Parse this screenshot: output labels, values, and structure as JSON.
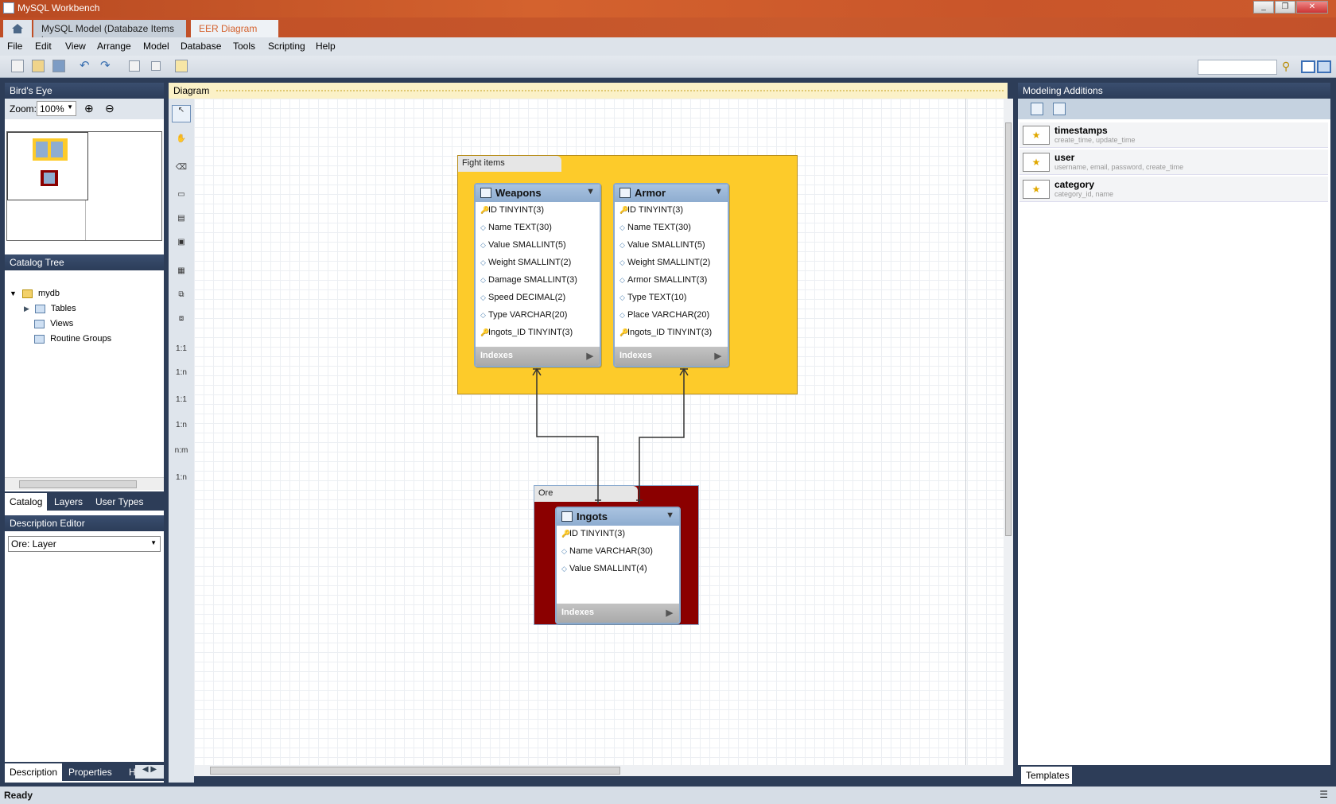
{
  "window": {
    "title": "MySQL Workbench",
    "controls": [
      "_",
      "❐",
      "✕"
    ]
  },
  "tabs": [
    {
      "label": "MySQL Model (Databaze Items in ..."
    },
    {
      "label": "EER Diagram",
      "close": "✕"
    }
  ],
  "menu": [
    "File",
    "Edit",
    "View",
    "Arrange",
    "Model",
    "Database",
    "Tools",
    "Scripting",
    "Help"
  ],
  "left": {
    "birds_eye_title": "Bird's Eye",
    "zoom_label": "Zoom:",
    "zoom_value": "100%",
    "catalog_title": "Catalog Tree",
    "tree": {
      "root": "mydb",
      "children": [
        "Tables",
        "Views",
        "Routine Groups"
      ]
    },
    "catalog_tabs": [
      "Catalog",
      "Layers",
      "User Types"
    ],
    "description_title": "Description Editor",
    "description_select": "Ore: Layer",
    "bottom_tabs": [
      "Description",
      "Properties",
      "H"
    ]
  },
  "diagram": {
    "title": "Diagram",
    "tool_labels": [
      "1:1",
      "1:n",
      "1:1",
      "1:n",
      "n:m",
      "1:n"
    ],
    "layers": [
      {
        "name": "Fight items",
        "color": "#fdcb2a"
      },
      {
        "name": "Ore",
        "color": "#8b0000"
      }
    ],
    "tables": [
      {
        "name": "Weapons",
        "columns": [
          "ID TINYINT(3)",
          "Name TEXT(30)",
          "Value SMALLINT(5)",
          "Weight SMALLINT(2)",
          "Damage SMALLINT(3)",
          "Speed DECIMAL(2)",
          "Type VARCHAR(20)",
          "Ingots_ID TINYINT(3)"
        ],
        "indexes": "Indexes"
      },
      {
        "name": "Armor",
        "columns": [
          "ID TINYINT(3)",
          "Name TEXT(30)",
          "Value SMALLINT(5)",
          "Weight SMALLINT(2)",
          "Armor SMALLINT(3)",
          "Type TEXT(10)",
          "Place VARCHAR(20)",
          "Ingots_ID TINYINT(3)"
        ],
        "indexes": "Indexes"
      },
      {
        "name": "Ingots",
        "columns": [
          "ID TINYINT(3)",
          "Name VARCHAR(30)",
          "Value SMALLINT(4)"
        ],
        "indexes": "Indexes"
      }
    ]
  },
  "right": {
    "title": "Modeling Additions",
    "additions": [
      {
        "title": "timestamps",
        "desc": "create_time, update_time"
      },
      {
        "title": "user",
        "desc": "username, email, password, create_time"
      },
      {
        "title": "category",
        "desc": "category_id, name"
      }
    ],
    "tab": "Templates"
  },
  "status": "Ready"
}
